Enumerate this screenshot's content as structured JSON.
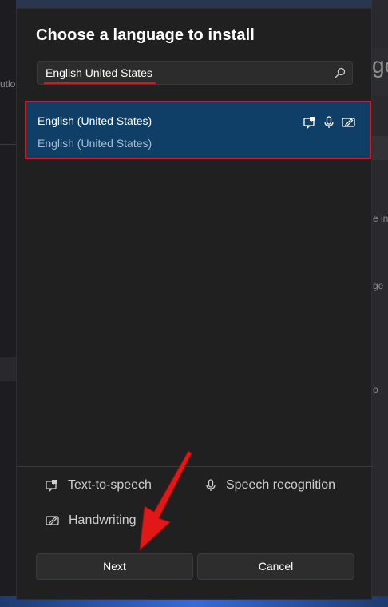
{
  "dialog": {
    "title": "Choose a language to install",
    "search": {
      "value": "English United States"
    },
    "result": {
      "name": "English (United States)",
      "native": "English (United States)",
      "features": [
        "text-to-speech-icon",
        "microphone-icon",
        "handwriting-icon"
      ]
    },
    "legend": {
      "tts": "Text-to-speech",
      "speech": "Speech recognition",
      "handwriting": "Handwriting"
    },
    "buttons": {
      "next": "Next",
      "cancel": "Cancel"
    }
  },
  "background": {
    "left_text": "utlo",
    "right_heading": "ge",
    "right_text_1": "e in",
    "right_text_2": "ge",
    "right_text_3": "o"
  },
  "colors": {
    "selection": "#0f3f66",
    "highlight": "#d01c1c",
    "dialog_bg": "#202020"
  }
}
